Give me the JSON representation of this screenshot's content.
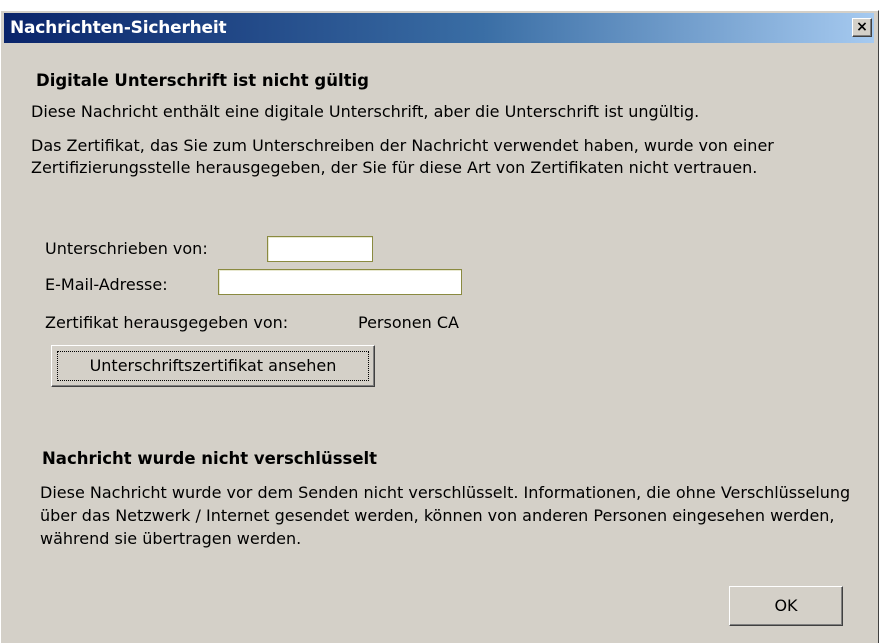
{
  "window": {
    "title": "Nachrichten-Sicherheit",
    "close_glyph": "×"
  },
  "signature": {
    "heading": "Digitale Unterschrift ist nicht gültig",
    "line1": "Diese Nachricht enthält eine digitale Unterschrift, aber die Unterschrift ist ungültig.",
    "line2": "Das Zertifikat, das Sie zum Unterschreiben der Nachricht verwendet haben, wurde von einer Zertifizierungsstelle herausgegeben, der Sie für diese Art von Zertifikaten nicht vertrauen.",
    "signed_by_label": "Unterschrieben von:",
    "signed_by_value": "",
    "email_label": "E-Mail-Adresse:",
    "email_value": "",
    "issuer_label": "Zertifikat herausgegeben von:",
    "issuer_value": "Personen CA",
    "view_cert_button": "Unterschriftszertifikat ansehen"
  },
  "encryption": {
    "heading": "Nachricht wurde nicht verschlüsselt",
    "text": "Diese Nachricht wurde vor dem Senden nicht verschlüsselt. Informationen, die ohne Verschlüsselung über das Netzwerk / Internet gesendet werden, können von anderen Personen eingesehen werden, während sie übertragen werden."
  },
  "ok_button": "OK",
  "colors": {
    "title_start": "#0a246a",
    "title_end": "#a6caf0",
    "dialog_bg": "#d4d0c8"
  }
}
